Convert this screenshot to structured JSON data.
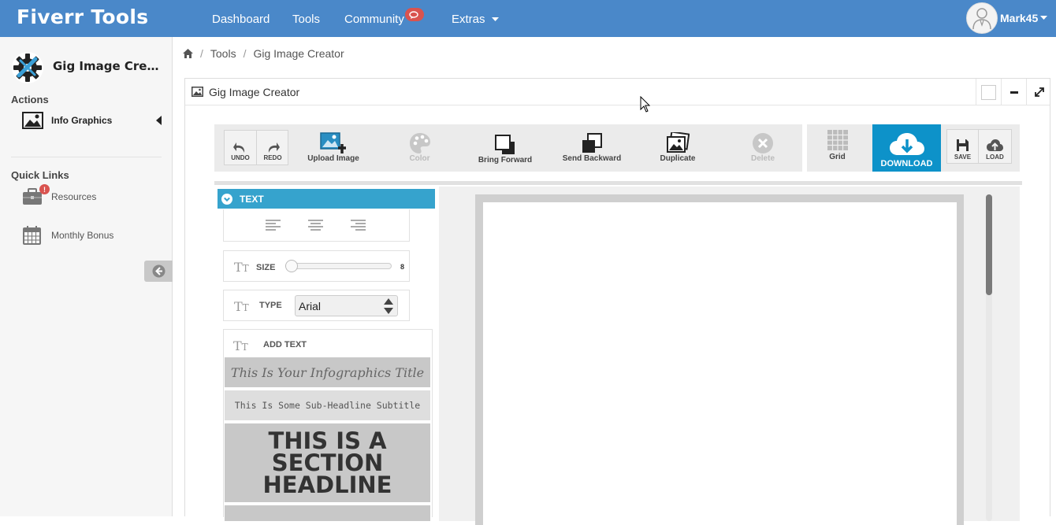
{
  "brand": "Fiverr Tools",
  "nav": {
    "items": [
      "Dashboard",
      "Tools",
      "Community",
      "Extras"
    ],
    "user": "Mark45"
  },
  "sidebar": {
    "app_name": "Gig Image Cre...",
    "actions_heading": "Actions",
    "actions": [
      {
        "label": "Info Graphics",
        "icon": "image-icon"
      }
    ],
    "quick_links_heading": "Quick Links",
    "quick_links": [
      {
        "label": "Resources",
        "icon": "briefcase-icon",
        "badge": "!"
      },
      {
        "label": "Monthly Bonus",
        "icon": "calendar-icon"
      }
    ]
  },
  "breadcrumb": [
    "Tools",
    "Gig Image Creator"
  ],
  "panel": {
    "title": "Gig Image Creator"
  },
  "toolbar": {
    "undo": "UNDO",
    "redo": "REDO",
    "upload_image": "Upload Image",
    "color": "Color",
    "bring_forward": "Bring Forward",
    "send_backward": "Send Backward",
    "duplicate": "Duplicate",
    "delete": "Delete",
    "grid": "Grid",
    "download": "DOWNLOAD",
    "save": "SAVE",
    "load": "LOAD"
  },
  "text_panel": {
    "heading": "TEXT",
    "size_label": "SIZE",
    "size_value": "8",
    "size_fraction": 0.0,
    "type_label": "TYPE",
    "type_value": "Arial",
    "add_text_label": "ADD TEXT",
    "templates": [
      "This Is Your Infographics Title",
      "This Is Some Sub-Headline Subtitle",
      "THIS IS A SECTION HEADLINE"
    ]
  },
  "colors": {
    "topbar": "#4a88c9",
    "text_header": "#36a3cd",
    "download": "#0d92c9",
    "badge": "#d9534f"
  }
}
